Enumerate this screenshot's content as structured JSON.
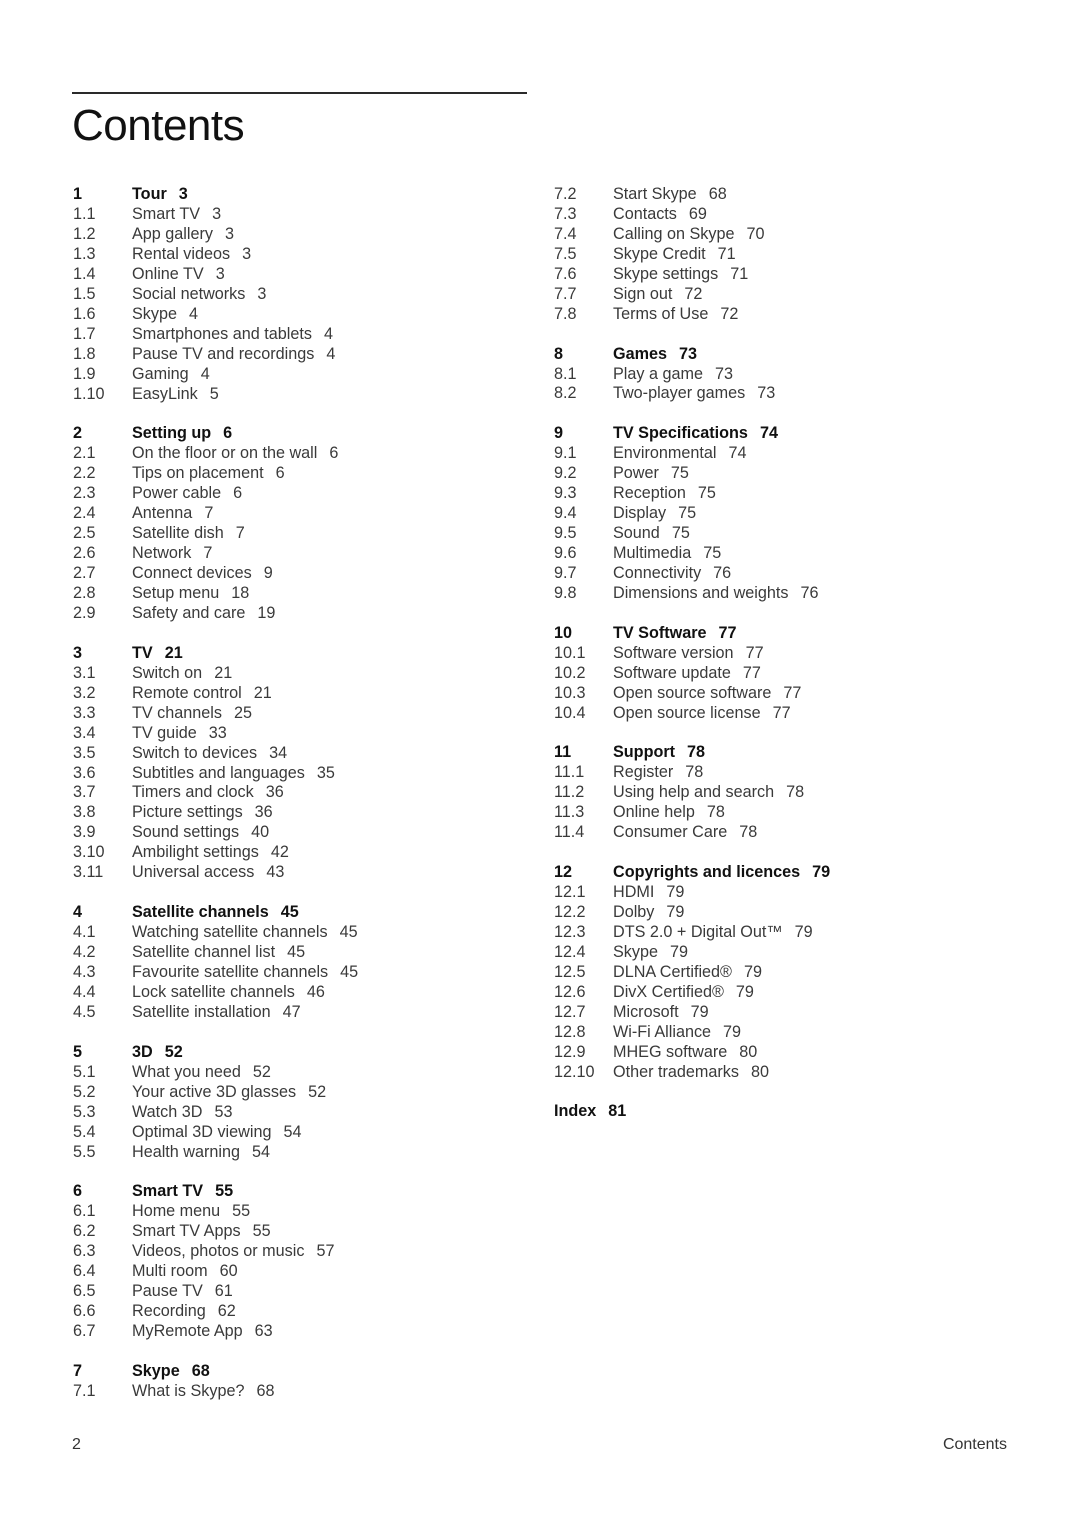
{
  "page": {
    "title": "Contents",
    "footer_page_number": "2",
    "footer_label": "Contents"
  },
  "left_column": [
    {
      "num": "1",
      "title": "Tour",
      "page": "3",
      "items": [
        {
          "num": "1.1",
          "title": "Smart TV",
          "page": "3"
        },
        {
          "num": "1.2",
          "title": "App gallery",
          "page": "3"
        },
        {
          "num": "1.3",
          "title": "Rental videos",
          "page": "3"
        },
        {
          "num": "1.4",
          "title": "Online TV",
          "page": "3"
        },
        {
          "num": "1.5",
          "title": "Social networks",
          "page": "3"
        },
        {
          "num": "1.6",
          "title": "Skype",
          "page": "4"
        },
        {
          "num": "1.7",
          "title": "Smartphones and tablets",
          "page": "4"
        },
        {
          "num": "1.8",
          "title": "Pause TV and recordings",
          "page": "4"
        },
        {
          "num": "1.9",
          "title": "Gaming",
          "page": "4"
        },
        {
          "num": "1.10",
          "title": "EasyLink",
          "page": "5"
        }
      ]
    },
    {
      "num": "2",
      "title": "Setting up",
      "page": "6",
      "items": [
        {
          "num": "2.1",
          "title": "On the floor or on the wall",
          "page": "6"
        },
        {
          "num": "2.2",
          "title": "Tips on placement",
          "page": "6"
        },
        {
          "num": "2.3",
          "title": "Power cable",
          "page": "6"
        },
        {
          "num": "2.4",
          "title": "Antenna",
          "page": "7"
        },
        {
          "num": "2.5",
          "title": "Satellite dish",
          "page": "7"
        },
        {
          "num": "2.6",
          "title": "Network",
          "page": "7"
        },
        {
          "num": "2.7",
          "title": "Connect devices",
          "page": "9"
        },
        {
          "num": "2.8",
          "title": "Setup menu",
          "page": "18"
        },
        {
          "num": "2.9",
          "title": "Safety and care",
          "page": "19"
        }
      ]
    },
    {
      "num": "3",
      "title": "TV",
      "page": "21",
      "items": [
        {
          "num": "3.1",
          "title": "Switch on",
          "page": "21"
        },
        {
          "num": "3.2",
          "title": "Remote control",
          "page": "21"
        },
        {
          "num": "3.3",
          "title": "TV channels",
          "page": "25"
        },
        {
          "num": "3.4",
          "title": "TV guide",
          "page": "33"
        },
        {
          "num": "3.5",
          "title": "Switch to devices",
          "page": "34"
        },
        {
          "num": "3.6",
          "title": "Subtitles and languages",
          "page": "35"
        },
        {
          "num": "3.7",
          "title": "Timers and clock",
          "page": "36"
        },
        {
          "num": "3.8",
          "title": "Picture settings",
          "page": "36"
        },
        {
          "num": "3.9",
          "title": "Sound settings",
          "page": "40"
        },
        {
          "num": "3.10",
          "title": "Ambilight settings",
          "page": "42"
        },
        {
          "num": "3.11",
          "title": "Universal access",
          "page": "43"
        }
      ]
    },
    {
      "num": "4",
      "title": "Satellite channels",
      "page": "45",
      "items": [
        {
          "num": "4.1",
          "title": "Watching satellite channels",
          "page": "45"
        },
        {
          "num": "4.2",
          "title": "Satellite channel list",
          "page": "45"
        },
        {
          "num": "4.3",
          "title": "Favourite satellite channels",
          "page": "45"
        },
        {
          "num": "4.4",
          "title": "Lock satellite channels",
          "page": "46"
        },
        {
          "num": "4.5",
          "title": "Satellite installation",
          "page": "47"
        }
      ]
    },
    {
      "num": "5",
      "title": "3D",
      "page": "52",
      "items": [
        {
          "num": "5.1",
          "title": "What you need",
          "page": "52"
        },
        {
          "num": "5.2",
          "title": "Your active 3D glasses",
          "page": "52"
        },
        {
          "num": "5.3",
          "title": "Watch 3D",
          "page": "53"
        },
        {
          "num": "5.4",
          "title": "Optimal 3D viewing",
          "page": "54"
        },
        {
          "num": "5.5",
          "title": "Health warning",
          "page": "54"
        }
      ]
    },
    {
      "num": "6",
      "title": "Smart TV",
      "page": "55",
      "items": [
        {
          "num": "6.1",
          "title": "Home menu",
          "page": "55"
        },
        {
          "num": "6.2",
          "title": "Smart TV Apps",
          "page": "55"
        },
        {
          "num": "6.3",
          "title": "Videos, photos or music",
          "page": "57"
        },
        {
          "num": "6.4",
          "title": "Multi room",
          "page": "60"
        },
        {
          "num": "6.5",
          "title": "Pause TV",
          "page": "61"
        },
        {
          "num": "6.6",
          "title": "Recording",
          "page": "62"
        },
        {
          "num": "6.7",
          "title": "MyRemote App",
          "page": "63"
        }
      ]
    },
    {
      "num": "7",
      "title": "Skype",
      "page": "68",
      "items": [
        {
          "num": "7.1",
          "title": "What is Skype?",
          "page": "68"
        }
      ]
    }
  ],
  "right_column": [
    {
      "num": "",
      "title": "",
      "page": "",
      "items": [
        {
          "num": "7.2",
          "title": "Start Skype",
          "page": "68"
        },
        {
          "num": "7.3",
          "title": "Contacts",
          "page": "69"
        },
        {
          "num": "7.4",
          "title": "Calling on Skype",
          "page": "70"
        },
        {
          "num": "7.5",
          "title": "Skype Credit",
          "page": "71"
        },
        {
          "num": "7.6",
          "title": "Skype settings",
          "page": "71"
        },
        {
          "num": "7.7",
          "title": "Sign out",
          "page": "72"
        },
        {
          "num": "7.8",
          "title": "Terms of Use",
          "page": "72"
        }
      ]
    },
    {
      "num": "8",
      "title": "Games",
      "page": "73",
      "items": [
        {
          "num": "8.1",
          "title": "Play a game",
          "page": "73"
        },
        {
          "num": "8.2",
          "title": "Two-player games",
          "page": "73"
        }
      ]
    },
    {
      "num": "9",
      "title": "TV Specifications",
      "page": "74",
      "items": [
        {
          "num": "9.1",
          "title": "Environmental",
          "page": "74"
        },
        {
          "num": "9.2",
          "title": "Power",
          "page": "75"
        },
        {
          "num": "9.3",
          "title": "Reception",
          "page": "75"
        },
        {
          "num": "9.4",
          "title": "Display",
          "page": "75"
        },
        {
          "num": "9.5",
          "title": "Sound",
          "page": "75"
        },
        {
          "num": "9.6",
          "title": "Multimedia",
          "page": "75"
        },
        {
          "num": "9.7",
          "title": "Connectivity",
          "page": "76"
        },
        {
          "num": "9.8",
          "title": "Dimensions and weights",
          "page": "76"
        }
      ]
    },
    {
      "num": "10",
      "title": "TV Software",
      "page": "77",
      "items": [
        {
          "num": "10.1",
          "title": "Software version",
          "page": "77"
        },
        {
          "num": "10.2",
          "title": "Software update",
          "page": "77"
        },
        {
          "num": "10.3",
          "title": "Open source software",
          "page": "77"
        },
        {
          "num": "10.4",
          "title": "Open source license",
          "page": "77"
        }
      ]
    },
    {
      "num": "11",
      "title": "Support",
      "page": "78",
      "items": [
        {
          "num": "11.1",
          "title": "Register",
          "page": "78"
        },
        {
          "num": "11.2",
          "title": "Using help and search",
          "page": "78"
        },
        {
          "num": "11.3",
          "title": "Online help",
          "page": "78"
        },
        {
          "num": "11.4",
          "title": "Consumer Care",
          "page": "78"
        }
      ]
    },
    {
      "num": "12",
      "title": "Copyrights and licences",
      "page": "79",
      "items": [
        {
          "num": "12.1",
          "title": "HDMI",
          "page": "79"
        },
        {
          "num": "12.2",
          "title": "Dolby",
          "page": "79"
        },
        {
          "num": "12.3",
          "title": "DTS 2.0 + Digital Out™",
          "page": "79"
        },
        {
          "num": "12.4",
          "title": "Skype",
          "page": "79"
        },
        {
          "num": "12.5",
          "title": "DLNA Certified®",
          "page": "79"
        },
        {
          "num": "12.6",
          "title": "DivX Certified®",
          "page": "79"
        },
        {
          "num": "12.7",
          "title": "Microsoft",
          "page": "79"
        },
        {
          "num": "12.8",
          "title": "Wi-Fi Alliance",
          "page": "79"
        },
        {
          "num": "12.9",
          "title": "MHEG software",
          "page": "80"
        },
        {
          "num": "12.10",
          "title": "Other trademarks",
          "page": "80"
        }
      ]
    }
  ],
  "index": {
    "title": "Index",
    "page": "81"
  }
}
